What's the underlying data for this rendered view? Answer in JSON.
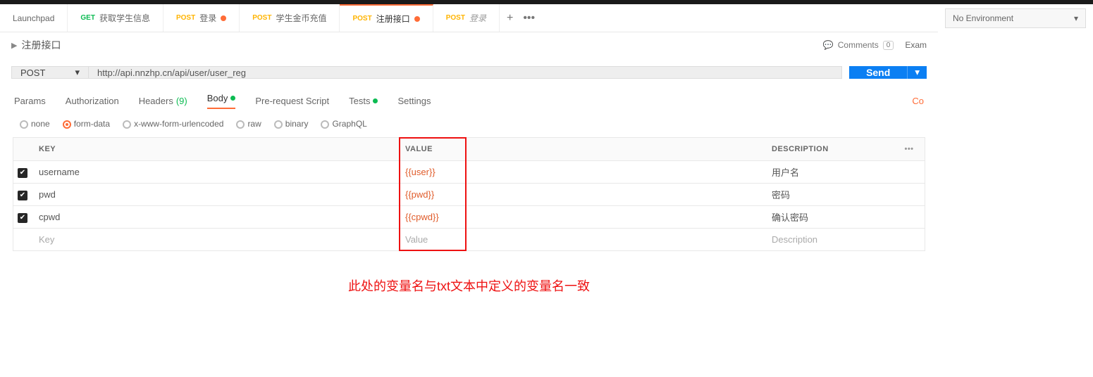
{
  "environment": {
    "label": "No Environment"
  },
  "tabs": [
    {
      "method": "",
      "label": "Launchpad",
      "methodClass": "",
      "hasDot": false,
      "italic": false
    },
    {
      "method": "GET",
      "label": "获取学生信息",
      "methodClass": "m-get",
      "hasDot": false,
      "italic": false
    },
    {
      "method": "POST",
      "label": "登录",
      "methodClass": "m-post",
      "hasDot": true,
      "italic": false
    },
    {
      "method": "POST",
      "label": "学生金币充值",
      "methodClass": "m-post",
      "hasDot": false,
      "italic": false
    },
    {
      "method": "POST",
      "label": "注册接口",
      "methodClass": "m-post",
      "hasDot": true,
      "italic": false,
      "active": true
    },
    {
      "method": "POST",
      "label": "登录",
      "methodClass": "m-post",
      "hasDot": false,
      "italic": true
    }
  ],
  "title": "注册接口",
  "comments": {
    "label": "Comments",
    "count": "0"
  },
  "examples": "Exam",
  "request": {
    "method": "POST",
    "url": "http://api.nnzhp.cn/api/user/user_reg",
    "send": "Send"
  },
  "subtabs": {
    "params": "Params",
    "authorization": "Authorization",
    "headers": "Headers",
    "headersCount": "(9)",
    "body": "Body",
    "prerequest": "Pre-request Script",
    "tests": "Tests",
    "settings": "Settings",
    "rightLink": "Co"
  },
  "bodyTypes": {
    "none": "none",
    "formdata": "form-data",
    "urlencoded": "x-www-form-urlencoded",
    "raw": "raw",
    "binary": "binary",
    "graphql": "GraphQL"
  },
  "table": {
    "headers": {
      "key": "KEY",
      "value": "VALUE",
      "description": "DESCRIPTION"
    },
    "rows": [
      {
        "key": "username",
        "value": "{{user}}",
        "description": "用户名"
      },
      {
        "key": "pwd",
        "value": "{{pwd}}",
        "description": "密码"
      },
      {
        "key": "cpwd",
        "value": "{{cpwd}}",
        "description": "确认密码"
      }
    ],
    "placeholders": {
      "key": "Key",
      "value": "Value",
      "description": "Description"
    }
  },
  "annotation": "此处的变量名与txt文本中定义的变量名一致"
}
